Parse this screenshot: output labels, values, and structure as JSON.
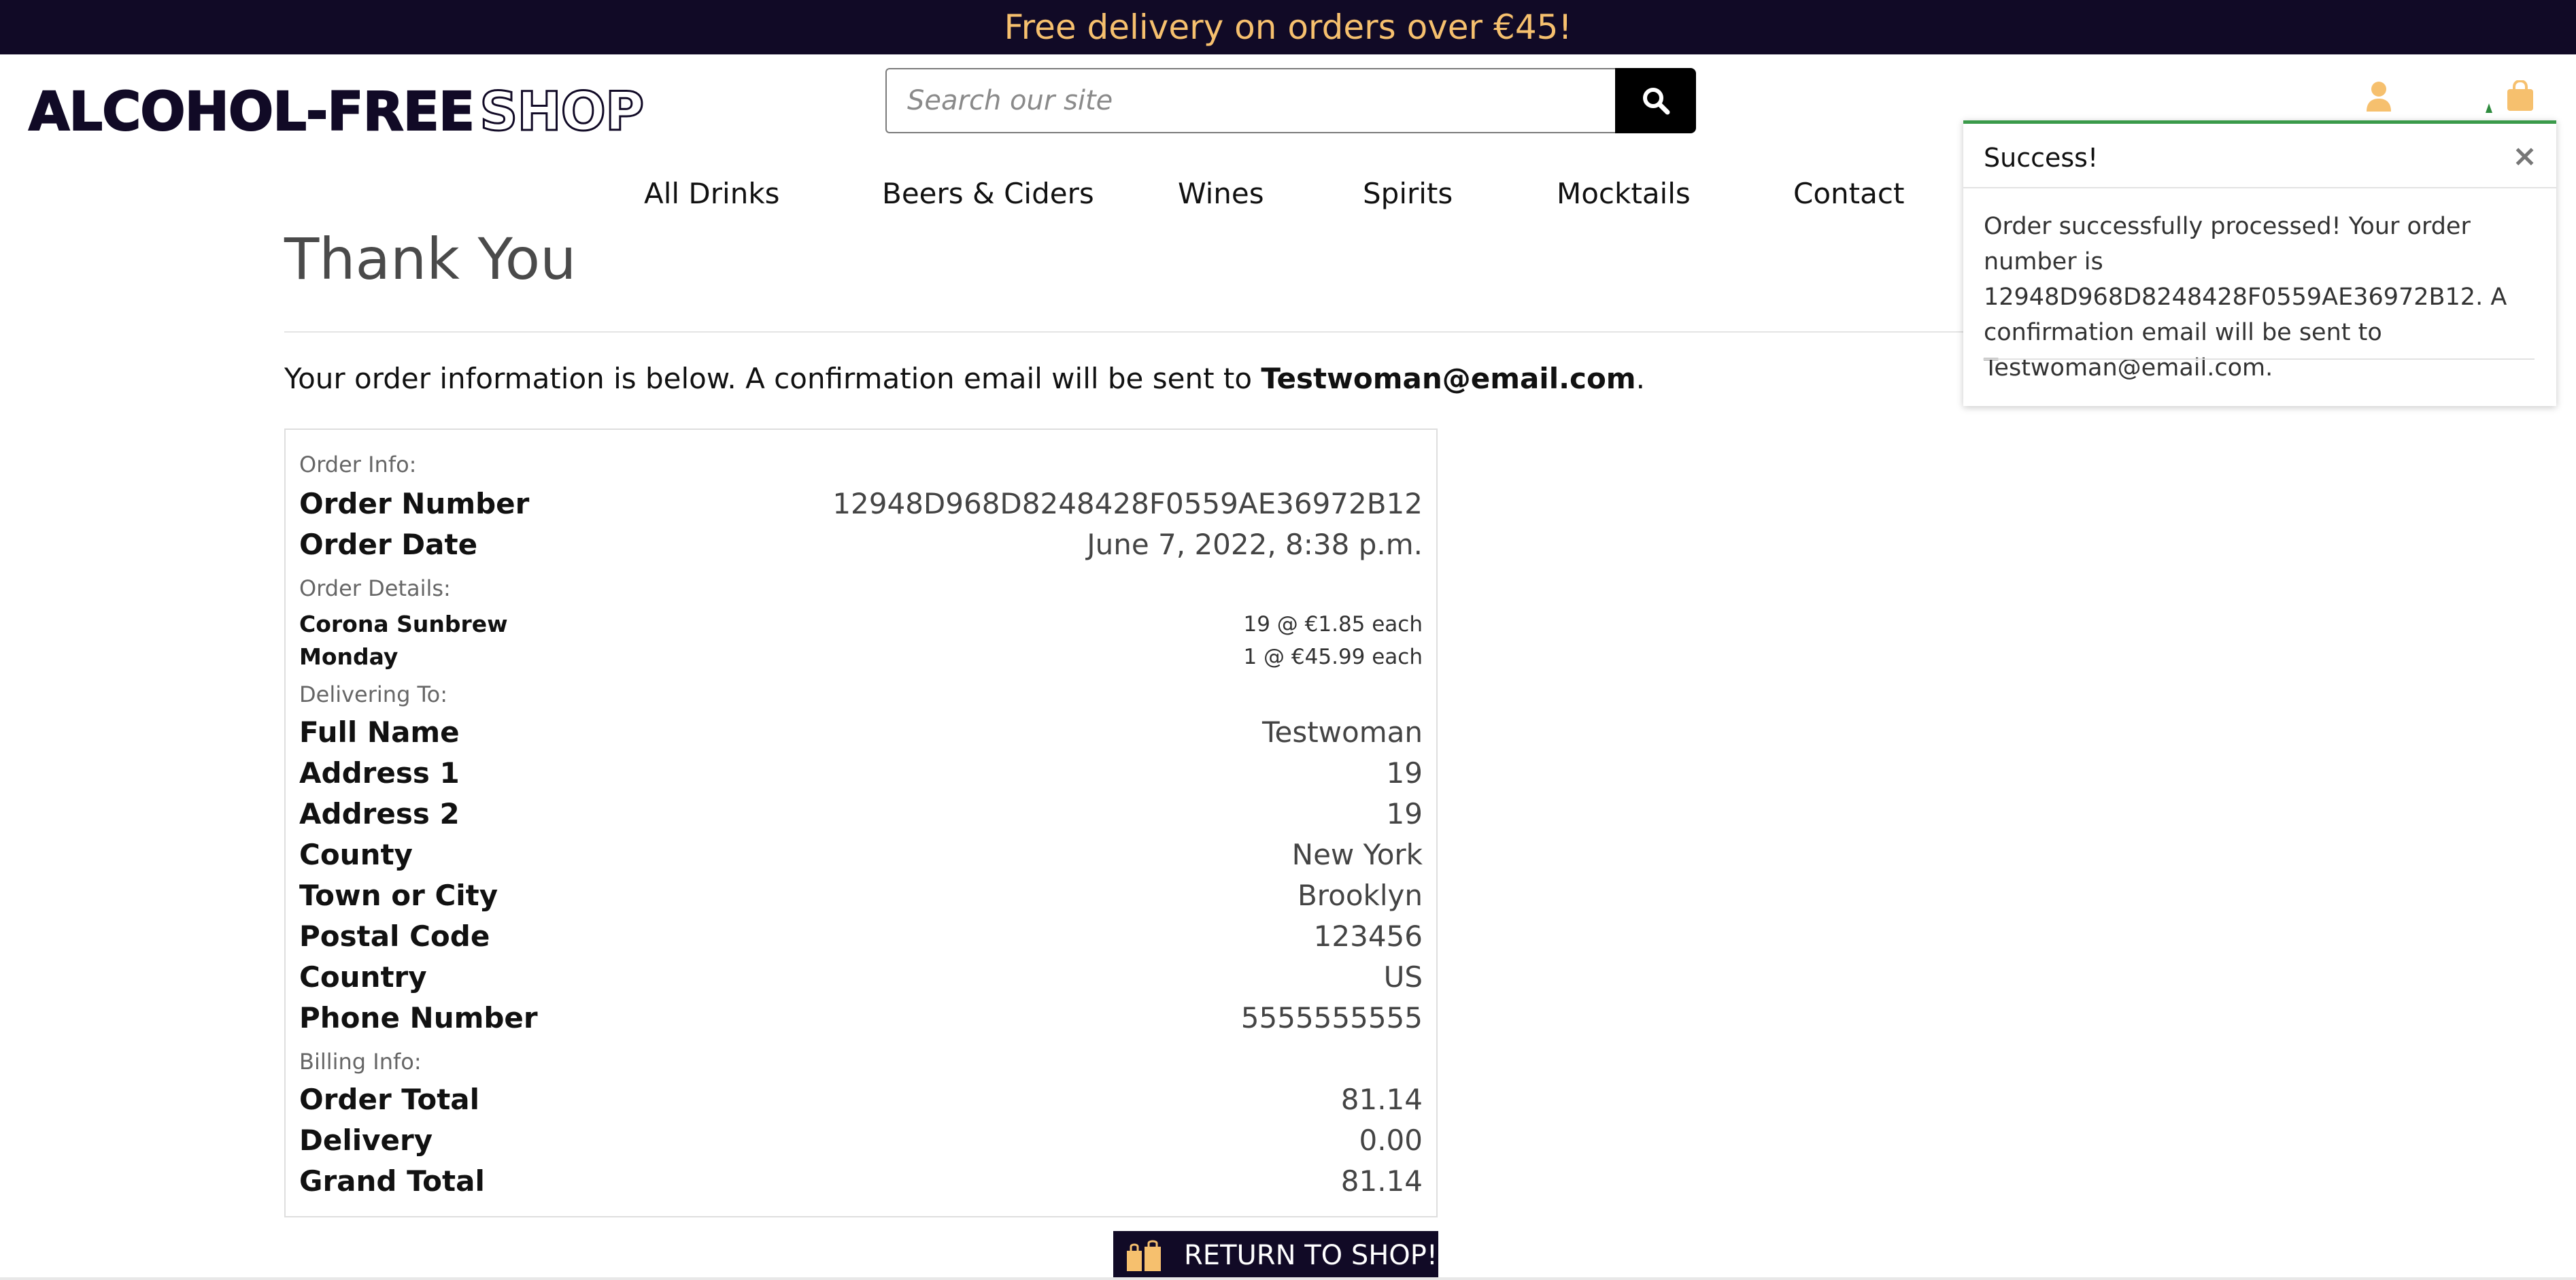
{
  "banner": {
    "text": "Free delivery on orders over €45!"
  },
  "logo": {
    "part1": "ALCOHOL-FREE",
    "part2": "SHOP"
  },
  "search": {
    "placeholder": "Search our site",
    "button_icon": "search-icon"
  },
  "header_icons": {
    "account": "user-icon",
    "bag": "shopping-bag-icon"
  },
  "colors": {
    "brand_dark": "#110a26",
    "accent": "#f6c06e",
    "success": "#3a9a4a"
  },
  "nav": {
    "items": [
      "All Drinks",
      "Beers & Ciders",
      "Wines",
      "Spirits",
      "Mocktails",
      "Contact"
    ]
  },
  "page": {
    "title": "Thank You",
    "intro_prefix": "Your order information is below. A confirmation email will be sent to ",
    "intro_email": "Testwoman@email.com",
    "intro_suffix": "."
  },
  "order": {
    "section_info": "Order Info:",
    "number_label": "Order Number",
    "number_value": "12948D968D8248428F0559AE36972B12",
    "date_label": "Order Date",
    "date_value": "June 7, 2022, 8:38 p.m.",
    "section_details": "Order Details:",
    "items": [
      {
        "name": "Corona Sunbrew",
        "qty": "19 @ €1.85 each"
      },
      {
        "name": "Monday",
        "qty": "1 @ €45.99 each"
      }
    ],
    "section_delivery": "Delivering To:",
    "delivery": [
      {
        "label": "Full Name",
        "value": "Testwoman"
      },
      {
        "label": "Address 1",
        "value": "19"
      },
      {
        "label": "Address 2",
        "value": "19"
      },
      {
        "label": "County",
        "value": "New York"
      },
      {
        "label": "Town or City",
        "value": "Brooklyn"
      },
      {
        "label": "Postal Code",
        "value": "123456"
      },
      {
        "label": "Country",
        "value": "US"
      },
      {
        "label": "Phone Number",
        "value": "5555555555"
      }
    ],
    "section_billing": "Billing Info:",
    "billing": [
      {
        "label": "Order Total",
        "value": "81.14"
      },
      {
        "label": "Delivery",
        "value": "0.00"
      },
      {
        "label": "Grand Total",
        "value": "81.14"
      }
    ]
  },
  "return_button": {
    "label": "RETURN TO SHOP!",
    "icon": "gift-bag-icon"
  },
  "toast": {
    "title": "Success!",
    "close": "×",
    "message": "Order successfully processed! Your order number is 12948D968D8248428F0559AE36972B12. A confirmation email will be sent to Testwoman@email.com."
  }
}
